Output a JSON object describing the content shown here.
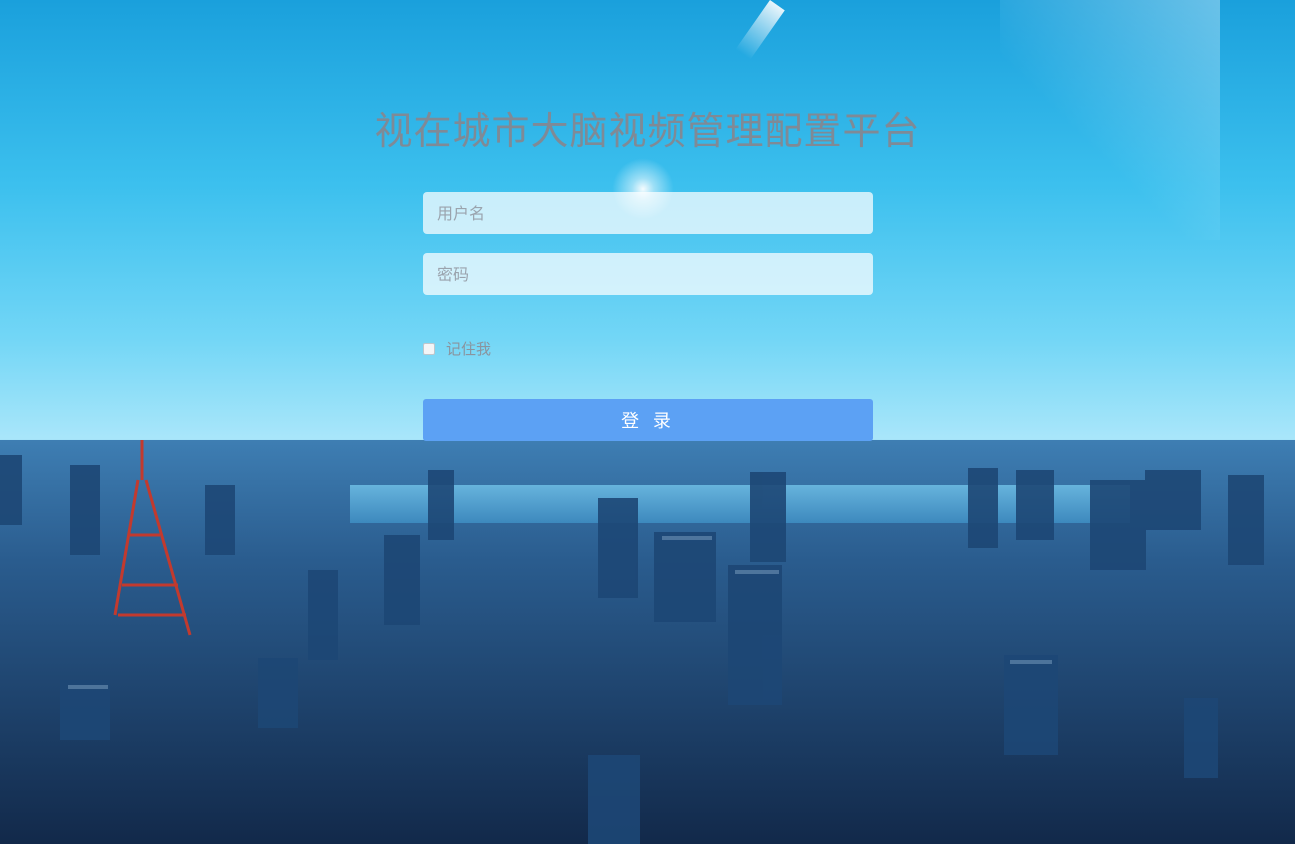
{
  "app": {
    "title": "视在城市大脑视频管理配置平台"
  },
  "login_form": {
    "username_placeholder": "用户名",
    "password_placeholder": "密码",
    "remember_me_label": "记住我",
    "login_button_label": "登 录"
  },
  "colors": {
    "login_button": "#5ca1f4",
    "title_text": "#7f8a96"
  }
}
